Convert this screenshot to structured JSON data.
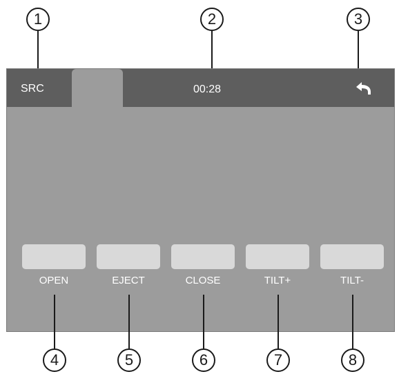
{
  "callouts": {
    "top": [
      "1",
      "2",
      "3"
    ],
    "bottom": [
      "4",
      "5",
      "6",
      "7",
      "8"
    ]
  },
  "topbar": {
    "src_label": "SRC",
    "time": "00:28",
    "back_icon": "back-arrow-icon"
  },
  "controls": [
    {
      "label": "OPEN"
    },
    {
      "label": "EJECT"
    },
    {
      "label": "CLOSE"
    },
    {
      "label": "TILT+"
    },
    {
      "label": "TILT-"
    }
  ],
  "colors": {
    "topbar_bg": "#5e5e5e",
    "screen_bg": "#9c9c9c",
    "button_bg": "#d9d9d9",
    "text": "#ffffff"
  }
}
